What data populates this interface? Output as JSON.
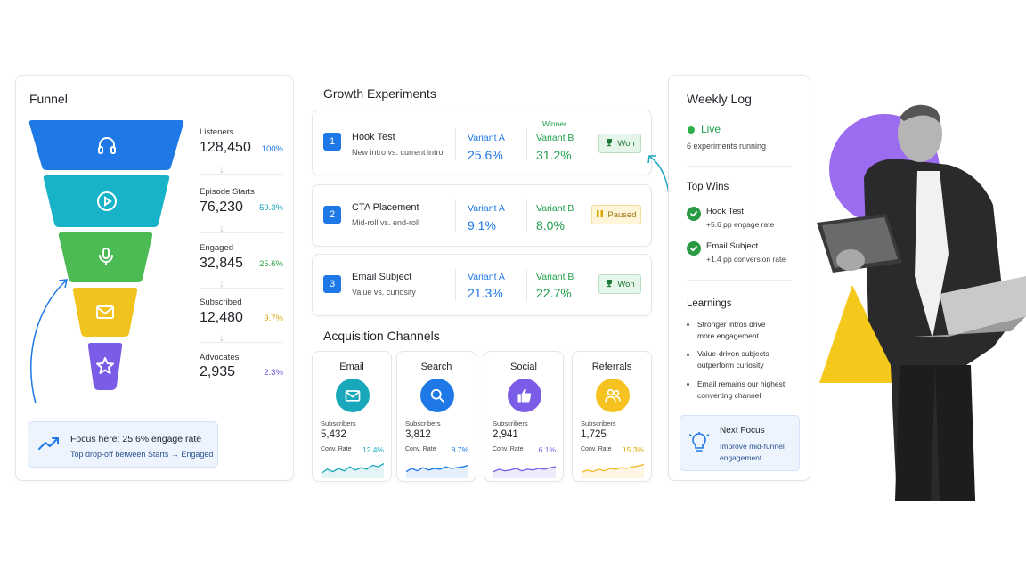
{
  "funnel": {
    "title": "Funnel",
    "stages": [
      {
        "label": "Listeners",
        "value": "128,450",
        "pct": "100%",
        "color": "#1e78e6",
        "pct_color": "#1e78e6",
        "icon": "headphones-icon"
      },
      {
        "label": "Episode Starts",
        "value": "76,230",
        "pct": "59.3%",
        "color": "#19b3c9",
        "pct_color": "#16a6b8",
        "icon": "play-icon"
      },
      {
        "label": "Engaged",
        "value": "32,845",
        "pct": "25.6%",
        "color": "#4cbb54",
        "pct_color": "#2e9d40",
        "icon": "microphone-icon"
      },
      {
        "label": "Subscribed",
        "value": "12,480",
        "pct": "9.7%",
        "color": "#f2c21f",
        "pct_color": "#d9a700",
        "icon": "mail-icon"
      },
      {
        "label": "Advocates",
        "value": "2,935",
        "pct": "2.3%",
        "color": "#7b5ce6",
        "pct_color": "#6a4fd6",
        "icon": "star-icon"
      }
    ],
    "focus": {
      "title": "Focus here: 25.6% engage rate",
      "subtitle": "Top drop-off between Starts → Engaged",
      "icon": "trend-up-icon"
    }
  },
  "experiments": {
    "title": "Growth Experiments",
    "winner_label": "Winner",
    "items": [
      {
        "num": "1",
        "title": "Hook Test",
        "desc": "New intro vs. current intro",
        "a_label": "Variant A",
        "a_value": "25.6%",
        "b_label": "Variant B",
        "b_value": "31.2%",
        "status": "Won",
        "status_type": "won",
        "b_winner": true
      },
      {
        "num": "2",
        "title": "CTA Placement",
        "desc": "Mid-roll vs. end-roll",
        "a_label": "Variant A",
        "a_value": "9.1%",
        "b_label": "Variant B",
        "b_value": "8.0%",
        "status": "Paused",
        "status_type": "paused",
        "b_winner": true
      },
      {
        "num": "3",
        "title": "Email Subject",
        "desc": "Value vs. curiosity",
        "a_label": "Variant A",
        "a_value": "21.3%",
        "b_label": "Variant B",
        "b_value": "22.7%",
        "status": "Won",
        "status_type": "won",
        "b_winner": true
      }
    ]
  },
  "channels": {
    "title": "Acquisition Channels",
    "sub_label": "Subscribers",
    "conv_label": "Conv. Rate",
    "items": [
      {
        "name": "Email",
        "subscribers": "5,432",
        "conv": "12.4%",
        "color": "#19a8bb",
        "bg": "#19a8bb",
        "icon": "mail-icon",
        "spark": [
          0.2,
          0.45,
          0.3,
          0.5,
          0.35,
          0.6,
          0.4,
          0.55,
          0.45,
          0.7,
          0.6,
          0.8
        ]
      },
      {
        "name": "Search",
        "subscribers": "3,812",
        "conv": "8.7%",
        "color": "#1e78e6",
        "bg": "#1e78e6",
        "icon": "search-icon",
        "spark": [
          0.3,
          0.5,
          0.35,
          0.55,
          0.4,
          0.5,
          0.45,
          0.6,
          0.5,
          0.55,
          0.6,
          0.7
        ]
      },
      {
        "name": "Social",
        "subscribers": "2,941",
        "conv": "6.1%",
        "color": "#7b5ce6",
        "bg": "#7b5ce6",
        "icon": "thumbs-up-icon",
        "spark": [
          0.3,
          0.45,
          0.35,
          0.4,
          0.5,
          0.35,
          0.45,
          0.4,
          0.5,
          0.45,
          0.55,
          0.6
        ]
      },
      {
        "name": "Referrals",
        "subscribers": "1,725",
        "conv": "15.3%",
        "color": "#f2b81f",
        "bg": "#f5c21f",
        "icon": "users-icon",
        "spark": [
          0.25,
          0.4,
          0.3,
          0.45,
          0.35,
          0.5,
          0.45,
          0.55,
          0.5,
          0.6,
          0.65,
          0.75
        ]
      }
    ]
  },
  "weekly_log": {
    "title": "Weekly Log",
    "live": "Live",
    "running": "6 experiments running",
    "top_wins_title": "Top Wins",
    "wins": [
      {
        "title": "Hook Test",
        "detail": "+5.6 pp engage rate"
      },
      {
        "title": "Email Subject",
        "detail": "+1.4 pp conversion rate"
      }
    ],
    "learnings_title": "Learnings",
    "learnings": [
      {
        "line1": "Stronger intros drive",
        "line2": "more engagement"
      },
      {
        "line1": "Value-driven subjects",
        "line2": "outperform curiosity"
      },
      {
        "line1": "Email remains our highest",
        "line2": "converting channel"
      }
    ],
    "next": {
      "title": "Next Focus",
      "line1": "Improve mid-funnel",
      "line2": "engagement",
      "icon": "lightbulb-icon"
    }
  },
  "accents": {
    "blue": "#1e78e6",
    "green": "#1e9e4a",
    "purple": "#7b5ce6",
    "yellow": "#f2c21f"
  }
}
